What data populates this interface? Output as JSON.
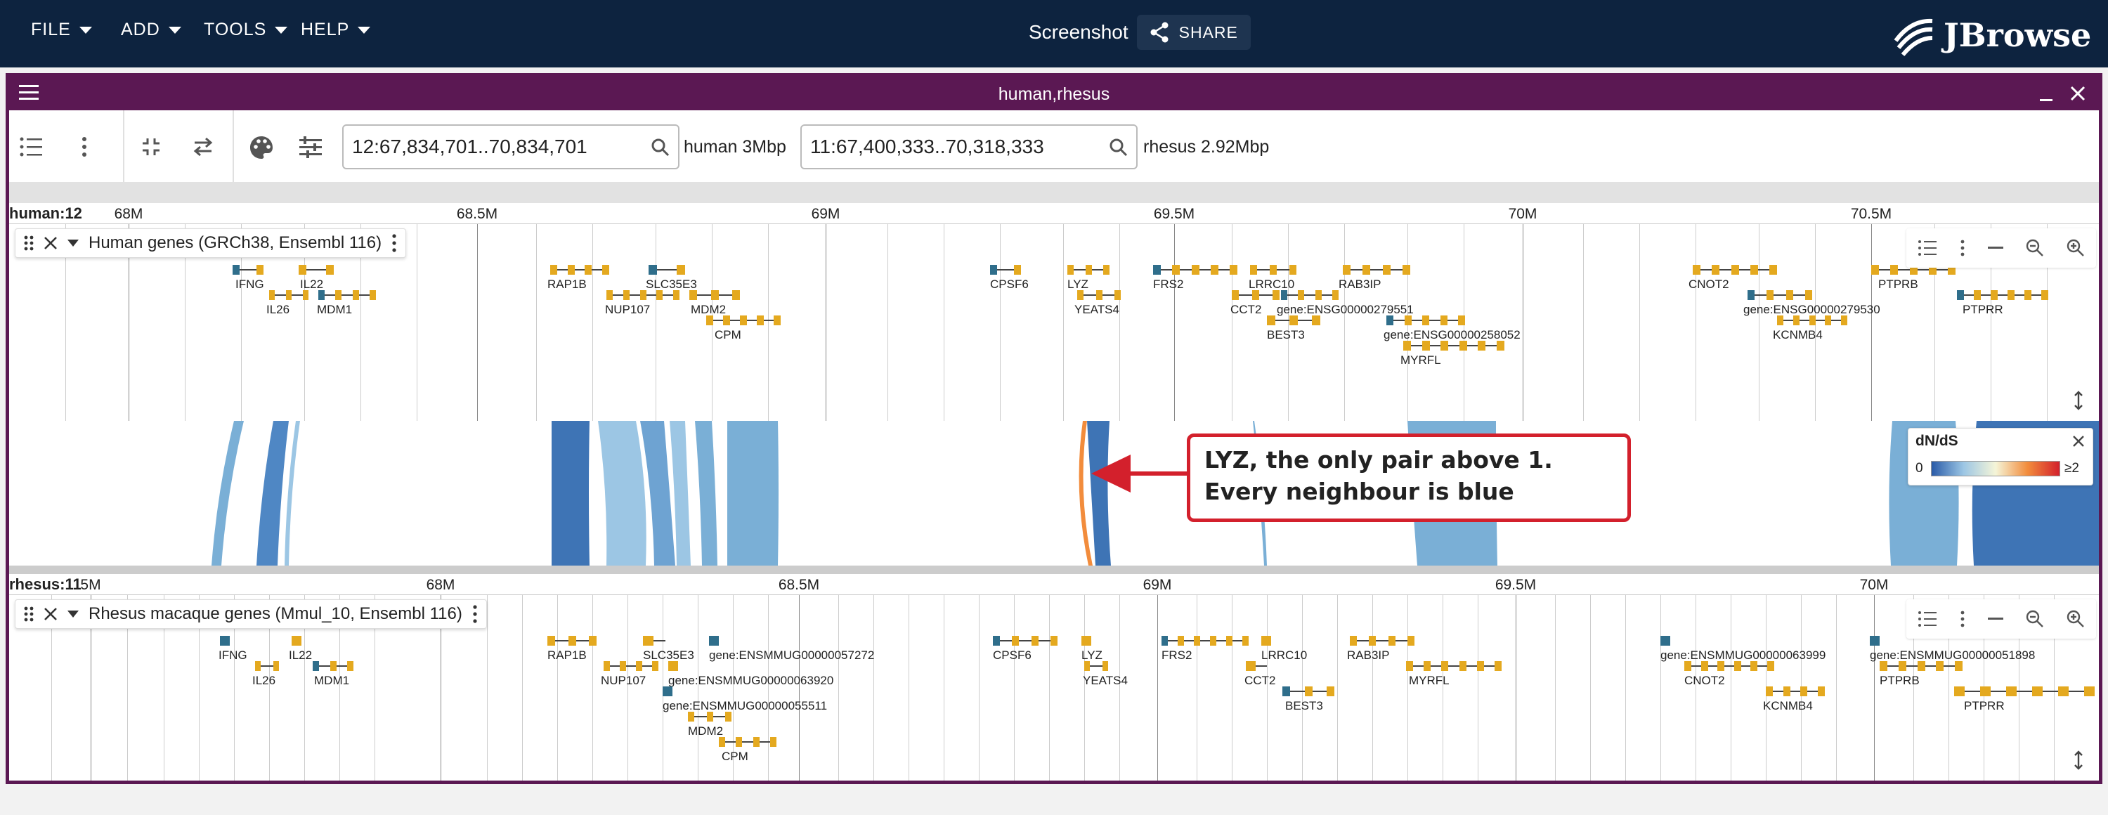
{
  "menu": {
    "file": "FILE",
    "add": "ADD",
    "tools": "TOOLS",
    "help": "HELP"
  },
  "header": {
    "screenshot": "Screenshot",
    "share": "SHARE",
    "logo": "JBrowse"
  },
  "view": {
    "title": "human,rhesus"
  },
  "toolbar": {
    "human_loc": "12:67,834,701..70,834,701",
    "human_size": "human 3Mbp",
    "rhesus_loc": "11:67,400,333..70,318,333",
    "rhesus_size": "rhesus 2.92Mbp"
  },
  "human": {
    "assembly": "human:12",
    "track": "Human genes (GRCh38, Ensembl 116)",
    "ticks": [
      "68M",
      "68.5M",
      "69M",
      "69.5M",
      "70M",
      "70.5M"
    ],
    "labels": [
      "IFNG",
      "IL22",
      "IL26",
      "MDM1",
      "RAP1B",
      "NUP107",
      "SLC35E3",
      "MDM2",
      "CPM",
      "CPSF6",
      "LYZ",
      "YEATS4",
      "FRS2",
      "LRRC10",
      "CCT2",
      "gene:ENSG00000279551",
      "BEST3",
      "RAB3IP",
      "gene:ENSG00000258052",
      "MYRFL",
      "CNOT2",
      "gene:ENSG00000279530",
      "KCNMB4",
      "PTPRB",
      "PTPRR"
    ]
  },
  "rhesus": {
    "assembly": "rhesus:11",
    "tick0": "5M",
    "track": "Rhesus macaque genes (Mmul_10, Ensembl 116)",
    "ticks": [
      "68M",
      "68.5M",
      "69M",
      "69.5M",
      "70M"
    ],
    "labels": [
      "IFNG",
      "IL22",
      "IL26",
      "MDM1",
      "RAP1B",
      "SLC35E3",
      "gene:ENSMMUG00000057272",
      "NUP107",
      "gene:ENSMMUG00000063920",
      "gene:ENSMMUG00000055511",
      "MDM2",
      "CPM",
      "CPSF6",
      "LYZ",
      "YEATS4",
      "FRS2",
      "LRRC10",
      "CCT2",
      "BEST3",
      "RAB3IP",
      "MYRFL",
      "gene:ENSMMUG00000063999",
      "CNOT2",
      "KCNMB4",
      "gene:ENSMMUG00000051898",
      "PTPRB",
      "PTPRR"
    ]
  },
  "legend": {
    "title": "dN/dS",
    "min": "0",
    "max": "≥2"
  },
  "callout": {
    "text": "LYZ, the only pair above 1. Every neighbour is blue"
  },
  "colors": {
    "topbar": "#0d233f",
    "view_border": "#5b1853",
    "exon": "#e4a91f",
    "callout": "#d3202c",
    "synteny_blue": "#3e74b5",
    "synteny_orange": "#f28c3c"
  }
}
